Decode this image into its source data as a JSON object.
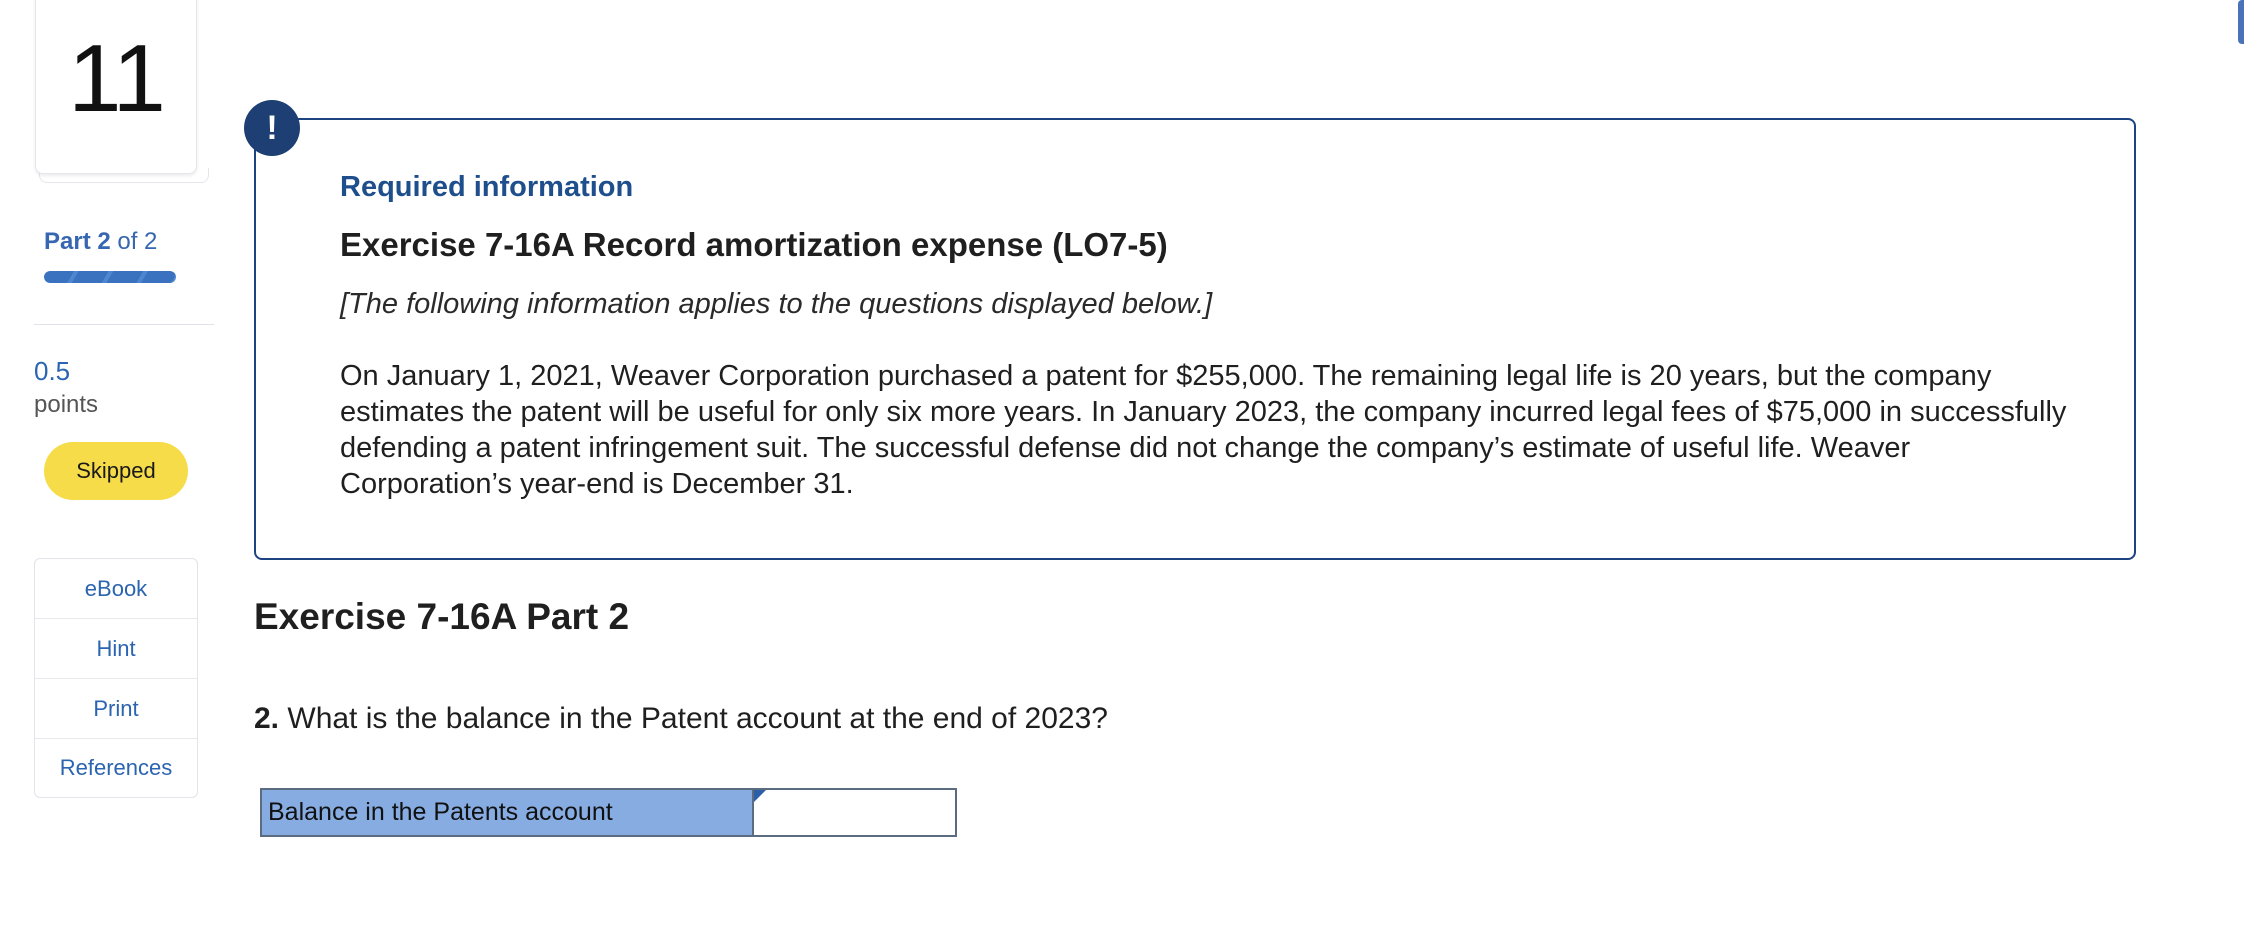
{
  "question": {
    "number": "11",
    "part_current": "Part 2",
    "part_total": "of 2",
    "progress_fraction": 1.0,
    "points": "0.5",
    "points_label": "points",
    "status_badge": "Skipped"
  },
  "tools": [
    {
      "label": "eBook"
    },
    {
      "label": "Hint"
    },
    {
      "label": "Print"
    },
    {
      "label": "References"
    }
  ],
  "info": {
    "alert_glyph": "!",
    "heading": "Required information",
    "exercise_title": "Exercise 7-16A Record amortization expense (LO7-5)",
    "applies_note": "[The following information applies to the questions displayed below.]",
    "scenario": "On January 1, 2021, Weaver Corporation purchased a patent for $255,000. The remaining legal life is 20 years, but the company estimates the patent will be useful for only six more years. In January 2023, the company incurred legal fees of $75,000 in successfully defending a patent infringement suit. The successful defense did not change the company’s estimate of useful life. Weaver Corporation’s year-end is December 31."
  },
  "part": {
    "heading": "Exercise 7-16A Part 2",
    "question_number": "2.",
    "question_text": "What is the balance in the Patent account at the end of 2023?"
  },
  "answer_table": {
    "row_label": "Balance in the Patents account",
    "value": ""
  },
  "colors": {
    "accent_blue": "#2b64b0",
    "badge_yellow": "#f7dc4a",
    "box_border": "#1e4382",
    "table_label_bg": "#86ace2"
  }
}
